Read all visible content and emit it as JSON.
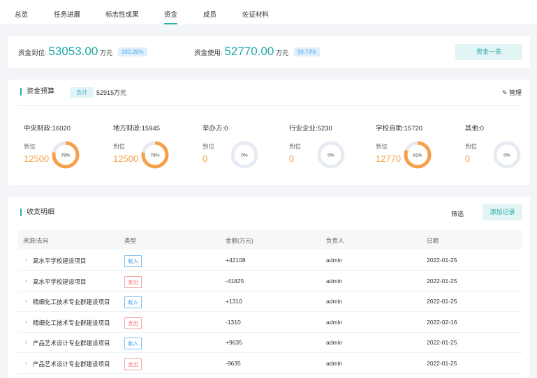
{
  "tabs": [
    "总览",
    "任务进展",
    "标志性成果",
    "资金",
    "成员",
    "佐证材料"
  ],
  "active_tab": "资金",
  "summary": {
    "received_label": "资金到位:",
    "received_value": "53053.00",
    "received_unit": "万元",
    "received_pct": "100.26%",
    "used_label": "资金使用:",
    "used_value": "52770.00",
    "used_unit": "万元",
    "used_pct": "99.73%",
    "overview_button": "资金一览"
  },
  "budget": {
    "title": "资金预算",
    "total_tag": "合计",
    "total_value": "52915万元",
    "manage": "管理",
    "arrived_label": "到位",
    "items": [
      {
        "name": "中央财政:16020",
        "arrived": "12500",
        "percent": 78,
        "percent_label": "78%"
      },
      {
        "name": "地方财政:15945",
        "arrived": "12500",
        "percent": 78,
        "percent_label": "78%"
      },
      {
        "name": "举办方:0",
        "arrived": "0",
        "percent": 0,
        "percent_label": "0%"
      },
      {
        "name": "行业企业:5230",
        "arrived": "0",
        "percent": 0,
        "percent_label": "0%"
      },
      {
        "name": "学校自助:15720",
        "arrived": "12770",
        "percent": 81,
        "percent_label": "81%"
      },
      {
        "name": "其他:0",
        "arrived": "0",
        "percent": 0,
        "percent_label": "0%"
      }
    ]
  },
  "ledger": {
    "title": "收支明细",
    "filter": "筛选",
    "add": "添加记录",
    "columns": [
      "来源/去向",
      "类型",
      "金额(万元)",
      "负责人",
      "日期"
    ],
    "rows": [
      {
        "source": "高水平学校建设项目",
        "type": "收入",
        "kind": "in",
        "amount": "+42108",
        "owner": "admin",
        "date": "2022-01-25"
      },
      {
        "source": "高水平学校建设项目",
        "type": "支出",
        "kind": "out",
        "amount": "-41825",
        "owner": "admin",
        "date": "2022-01-25"
      },
      {
        "source": "精细化工技术专业群建设项目",
        "type": "收入",
        "kind": "in",
        "amount": "+1310",
        "owner": "admin",
        "date": "2022-01-25"
      },
      {
        "source": "精细化工技术专业群建设项目",
        "type": "支出",
        "kind": "out",
        "amount": "-1310",
        "owner": "admin",
        "date": "2022-02-16"
      },
      {
        "source": "产品艺术设计专业群建设项目",
        "type": "收入",
        "kind": "in",
        "amount": "+9635",
        "owner": "admin",
        "date": "2022-01-25"
      },
      {
        "source": "产品艺术设计专业群建设项目",
        "type": "支出",
        "kind": "out",
        "amount": "-9635",
        "owner": "admin",
        "date": "2022-01-25"
      }
    ]
  },
  "colors": {
    "accent": "#22b2b0",
    "orange": "#f5a04b",
    "ring": "#e6ebf3"
  }
}
